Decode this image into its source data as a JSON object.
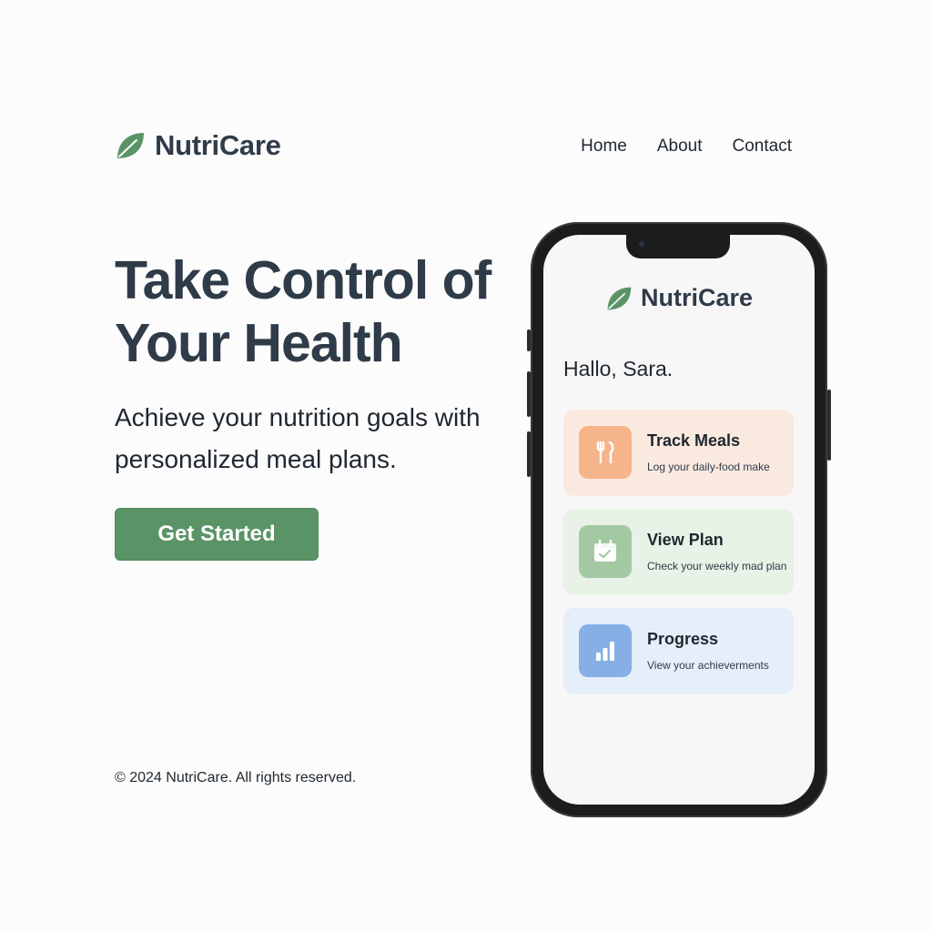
{
  "header": {
    "brand": "NutriCare",
    "nav": [
      "Home",
      "About",
      "Contact"
    ]
  },
  "hero": {
    "title": "Take Control of Your Health",
    "subtitle": "Achieve your nutrition goals with personalized meal plans.",
    "cta_label": "Get Started"
  },
  "footer": {
    "copyright": "© 2024 NutriCare. All rights reserved."
  },
  "phone": {
    "brand": "NutriCare",
    "greeting": "Hallo, Sara.",
    "cards": [
      {
        "title": "Track Meals",
        "description": "Log your daily-food make",
        "icon": "fork-knife-icon",
        "color": "#f6b48a"
      },
      {
        "title": "View Plan",
        "description": "Check your weekly mad plan",
        "icon": "calendar-icon",
        "color": "#a3c9a3"
      },
      {
        "title": "Progress",
        "description": "View your achieverments",
        "icon": "bar-chart-icon",
        "color": "#86afe6"
      }
    ]
  },
  "colors": {
    "brand_green": "#5a9466",
    "text_dark": "#2f3b48"
  }
}
